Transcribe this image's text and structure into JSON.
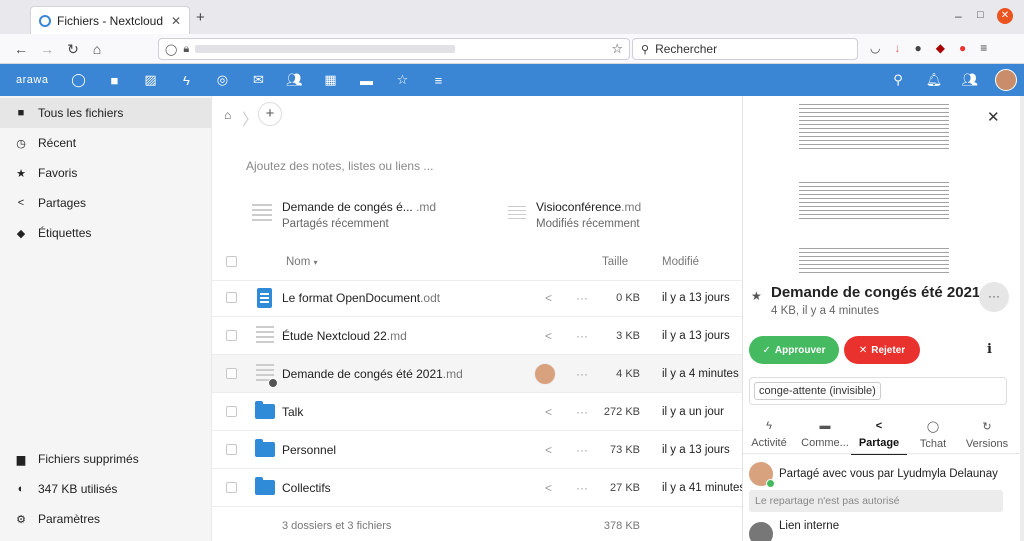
{
  "browser": {
    "tab_title": "Fichiers - Nextcloud",
    "search_placeholder": "Rechercher"
  },
  "header": {
    "logo": "arawa",
    "icons": [
      "circle-icon",
      "folder-icon",
      "image-icon",
      "activity-icon",
      "talk-icon",
      "mail-icon",
      "contacts-icon",
      "calendar-icon",
      "deck-icon",
      "star-icon",
      "notes-icon"
    ]
  },
  "sidebar": {
    "items": [
      {
        "label": "Tous les fichiers",
        "icon": "folder-icon"
      },
      {
        "label": "Récent",
        "icon": "clock-icon"
      },
      {
        "label": "Favoris",
        "icon": "star-icon"
      },
      {
        "label": "Partages",
        "icon": "share-icon"
      },
      {
        "label": "Étiquettes",
        "icon": "tag-icon"
      }
    ],
    "bottom": {
      "deleted": "Fichiers supprimés",
      "quota": "347 KB utilisés",
      "settings": "Paramètres"
    }
  },
  "main": {
    "notes_placeholder": "Ajoutez des notes, listes ou liens ...",
    "recent": [
      {
        "name": "Demande de congés é... ",
        "ext": ".md",
        "sub": "Partagés récemment"
      },
      {
        "name": "Visioconférence",
        "ext": ".md",
        "sub": "Modifiés récemment"
      }
    ],
    "columns": {
      "name": "Nom",
      "size": "Taille",
      "modified": "Modifié"
    },
    "files": [
      {
        "name": "Le format OpenDocument",
        "ext": ".odt",
        "size": "0 KB",
        "modified": "il y a 13 jours",
        "type": "odt"
      },
      {
        "name": "Étude Nextcloud 22",
        "ext": ".md",
        "size": "3 KB",
        "modified": "il y a 13 jours",
        "type": "md"
      },
      {
        "name": "Demande de congés été 2021",
        "ext": ".md",
        "size": "4 KB",
        "modified": "il y a 4 minutes",
        "type": "md-shared"
      },
      {
        "name": "Talk",
        "ext": "",
        "size": "272 KB",
        "modified": "il y a un jour",
        "type": "folder"
      },
      {
        "name": "Personnel",
        "ext": "",
        "size": "73 KB",
        "modified": "il y a 13 jours",
        "type": "folder"
      },
      {
        "name": "Collectifs",
        "ext": "",
        "size": "27 KB",
        "modified": "il y a 41 minutes",
        "type": "folder"
      }
    ],
    "summary": {
      "label": "3 dossiers et 3 fichiers",
      "size": "378 KB"
    }
  },
  "panel": {
    "title": "Demande de congés été 2021....",
    "meta": "4 KB, il y a 4 minutes",
    "approve": "Approuver",
    "reject": "Rejeter",
    "tag": "conge-attente (invisible)",
    "tabs": [
      {
        "label": "Activité",
        "icon": "activity-icon"
      },
      {
        "label": "Comme...",
        "icon": "comment-icon"
      },
      {
        "label": "Partage",
        "icon": "share-icon"
      },
      {
        "label": "Tchat",
        "icon": "chat-icon"
      },
      {
        "label": "Versions",
        "icon": "history-icon"
      }
    ],
    "shared_by": "Partagé avec vous par Lyudmyla Delaunay",
    "reshare_note": "Le repartage n'est pas autorisé",
    "internal_link": "Lien interne",
    "colors": {
      "approve": "#46ba61",
      "reject": "#e9322d",
      "accent": "#3b86d4"
    }
  }
}
